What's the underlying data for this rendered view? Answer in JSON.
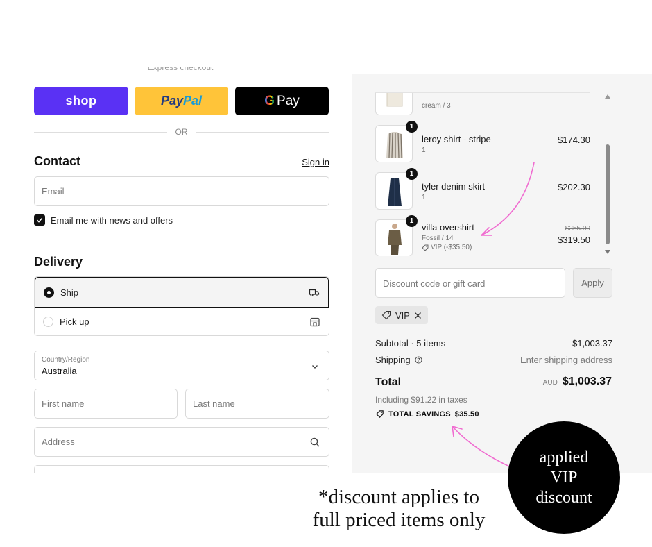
{
  "express": {
    "label": "Express checkout"
  },
  "payments": {
    "shop": "shop",
    "paypal_a": "Pay",
    "paypal_b": "Pal",
    "gpay_g": "G",
    "gpay": "Pay"
  },
  "divider": {
    "or": "OR"
  },
  "contact": {
    "title": "Contact",
    "sign_in": "Sign in",
    "email_placeholder": "Email",
    "newsletter_label": "Email me with news and offers",
    "newsletter_checked": true
  },
  "delivery": {
    "title": "Delivery",
    "options": [
      {
        "label": "Ship",
        "selected": true,
        "icon": "truck-icon"
      },
      {
        "label": "Pick up",
        "selected": false,
        "icon": "store-icon"
      }
    ],
    "country_label": "Country/Region",
    "country_value": "Australia",
    "first_name_placeholder": "First name",
    "last_name_placeholder": "Last name",
    "address_placeholder": "Address"
  },
  "cart": {
    "items": [
      {
        "name": "",
        "variant": "cream / 3",
        "qty": "",
        "price": ""
      },
      {
        "name": "leroy shirt - stripe",
        "variant": "1",
        "qty": "1",
        "price": "$174.30"
      },
      {
        "name": "tyler denim skirt",
        "variant": "1",
        "qty": "1",
        "price": "$202.30"
      },
      {
        "name": "villa overshirt",
        "variant": "Fossil / 14",
        "discount": "VIP (-$35.50)",
        "qty": "1",
        "original_price": "$355.00",
        "price": "$319.50"
      }
    ],
    "discount_placeholder": "Discount code or gift card",
    "apply": "Apply",
    "applied_code": "VIP"
  },
  "summary": {
    "subtotal_label": "Subtotal · 5 items",
    "subtotal_value": "$1,003.37",
    "shipping_label": "Shipping",
    "shipping_value": "Enter shipping address",
    "total_label": "Total",
    "currency": "AUD",
    "total_value": "$1,003.37",
    "taxes": "Including $91.22 in taxes",
    "savings_label": "TOTAL SAVINGS",
    "savings_value": "$35.50"
  },
  "annotations": {
    "circle_line1": "applied",
    "circle_line2": "VIP",
    "circle_line3": "discount",
    "note_line1": "*discount applies to",
    "note_line2": "full priced items only",
    "arrow_color": "#f06bd0"
  },
  "colors": {
    "shop": "#5a31f4",
    "paypal": "#ffc439",
    "gpay": "#000000",
    "panel": "#f5f5f5"
  }
}
